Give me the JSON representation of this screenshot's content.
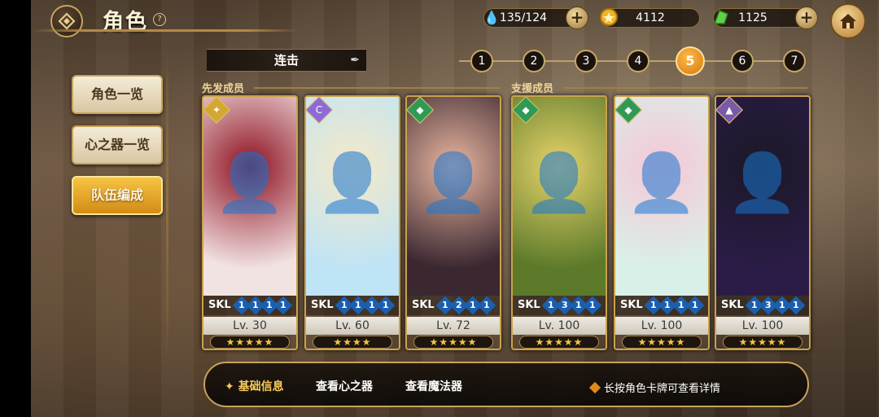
{
  "header": {
    "title": "角色",
    "help": "?"
  },
  "resources": [
    {
      "name": "stamina",
      "value": "135/124",
      "icon": "water-drop-icon",
      "color": "#3aa3e8",
      "has_plus": true
    },
    {
      "name": "coins",
      "value": "4112",
      "icon": "gold-coin-icon",
      "color": "#f0b62a",
      "has_plus": false
    },
    {
      "name": "gems",
      "value": "1125",
      "icon": "green-gem-icon",
      "color": "#5fd04a",
      "has_plus": true
    }
  ],
  "menu": [
    {
      "label": "角色一览",
      "active": false
    },
    {
      "label": "心之器一览",
      "active": false
    },
    {
      "label": "队伍编成",
      "active": true
    }
  ],
  "combo_label": "连击",
  "steps": [
    "1",
    "2",
    "3",
    "4",
    "5",
    "6",
    "7"
  ],
  "active_step": "5",
  "sections": {
    "front": "先发成员",
    "support": "支援成员"
  },
  "cards": [
    {
      "skl_label": "SKL",
      "skl": [
        "1",
        "1",
        "1",
        "1"
      ],
      "level": "Lv. 30",
      "stars": "★★★★★",
      "badge": "✦",
      "badge_color": "#d3a832",
      "colors": [
        "#f2e3e3",
        "#8e1020"
      ]
    },
    {
      "skl_label": "SKL",
      "skl": [
        "1",
        "1",
        "1",
        "1"
      ],
      "level": "Lv. 60",
      "stars": "★★★★",
      "badge": "C",
      "badge_color": "#8e6ad6",
      "colors": [
        "#bfe4f5",
        "#f5e9c8"
      ]
    },
    {
      "skl_label": "SKL",
      "skl": [
        "1",
        "2",
        "1",
        "1"
      ],
      "level": "Lv. 72",
      "stars": "★★★★★",
      "badge": "◆",
      "badge_color": "#2f9a54",
      "colors": [
        "#3a2730",
        "#e9b6a0"
      ]
    },
    {
      "skl_label": "SKL",
      "skl": [
        "1",
        "3",
        "1",
        "1"
      ],
      "level": "Lv. 100",
      "stars": "★★★★★",
      "badge": "◆",
      "badge_color": "#2f9a54",
      "colors": [
        "#5c7a2a",
        "#e6d36a"
      ]
    },
    {
      "skl_label": "SKL",
      "skl": [
        "1",
        "1",
        "1",
        "1"
      ],
      "level": "Lv. 100",
      "stars": "★★★★★",
      "badge": "◆",
      "badge_color": "#2f9a54",
      "colors": [
        "#d9f0e8",
        "#f6c7d6"
      ]
    },
    {
      "skl_label": "SKL",
      "skl": [
        "1",
        "3",
        "1",
        "1"
      ],
      "level": "Lv. 100",
      "stars": "★★★★★",
      "badge": "▲",
      "badge_color": "#7a5aa8",
      "colors": [
        "#2a1c46",
        "#1b1826"
      ]
    }
  ],
  "bottom": {
    "tabs": [
      {
        "label": "基础信息",
        "active": true
      },
      {
        "label": "查看心之器",
        "active": false
      },
      {
        "label": "查看魔法器",
        "active": false
      }
    ],
    "hint": "长按角色卡牌可查看详情"
  }
}
